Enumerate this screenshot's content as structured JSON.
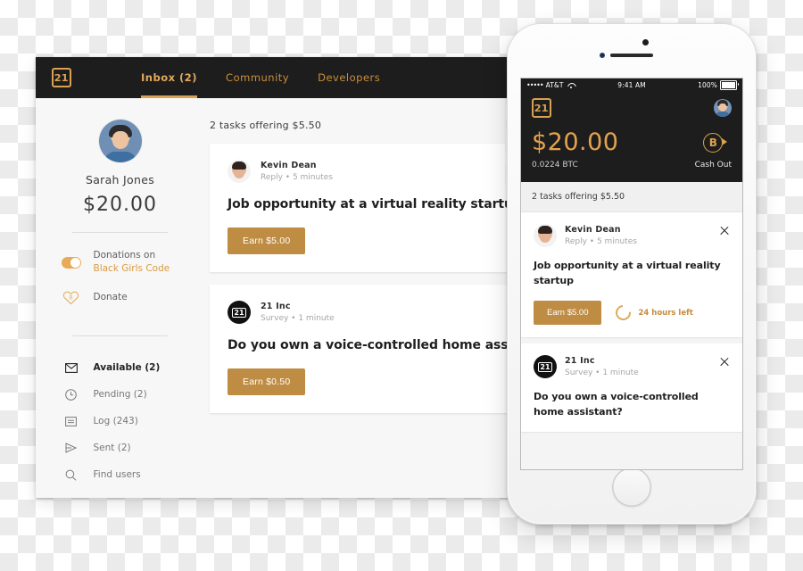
{
  "desktop": {
    "nav": {
      "logo": "21-logo-icon",
      "logo_char": "21",
      "tabs": [
        {
          "label": "Inbox (2)",
          "active": true
        },
        {
          "label": "Community",
          "active": false
        },
        {
          "label": "Developers",
          "active": false
        }
      ]
    },
    "sidebar": {
      "user_name": "Sarah Jones",
      "balance": "$20.00",
      "donation": {
        "toggle_state": "on",
        "label": "Donations on",
        "charity": "Black Girls Code"
      },
      "donate": {
        "label": "Donate",
        "icon": "heart-bitcoin-icon"
      },
      "nav_items": [
        {
          "label": "Available (2)",
          "icon": "envelope-icon",
          "active": true
        },
        {
          "label": "Pending (2)",
          "icon": "clock-icon",
          "active": false
        },
        {
          "label": "Log (243)",
          "icon": "list-icon",
          "active": false
        },
        {
          "label": "Sent (2)",
          "icon": "send-icon",
          "active": false
        },
        {
          "label": "Find users",
          "icon": "search-icon",
          "active": false
        }
      ]
    },
    "feed": {
      "summary": "2 tasks offering $5.50",
      "cards": [
        {
          "sender": "Kevin Dean",
          "meta": "Reply • 5 minutes",
          "title": "Job opportunity at a virtual reality startup",
          "button": "Earn $5.00",
          "avatar": "kevin-dean-avatar"
        },
        {
          "sender": "21 Inc",
          "meta": "Survey • 1 minute",
          "title": "Do you own a voice-controlled home assistant?",
          "button": "Earn $0.50",
          "avatar": "21-inc-avatar"
        }
      ]
    }
  },
  "phone": {
    "status_bar": {
      "signal_dots": "•••••",
      "carrier": "AT&T",
      "wifi": "wifi-icon",
      "time": "9:41 AM",
      "battery_pct": "100%"
    },
    "header": {
      "logo_char": "21",
      "avatar": "user-avatar",
      "amount": "$20.00",
      "btc": "0.0224 BTC",
      "cash_out_label": "Cash Out",
      "cash_out_icon": "bitcoin-cashout-icon"
    },
    "feed": {
      "summary": "2 tasks offering $5.50",
      "cards": [
        {
          "sender": "Kevin Dean",
          "meta": "Reply • 5 minutes",
          "title": "Job opportunity at a virtual reality startup",
          "button": "Earn $5.00",
          "timer": "24 hours left",
          "close": "close-icon"
        },
        {
          "sender": "21 Inc",
          "meta": "Survey • 1 minute",
          "title": "Do you own a voice-controlled home assistant?",
          "close": "close-icon"
        }
      ]
    }
  },
  "colors": {
    "accent_gold": "#d9a152",
    "button_gold": "#bf8c43",
    "dark": "#1d1d1d",
    "amount_gold": "#e3a24e",
    "charity_link": "#d99a45"
  }
}
